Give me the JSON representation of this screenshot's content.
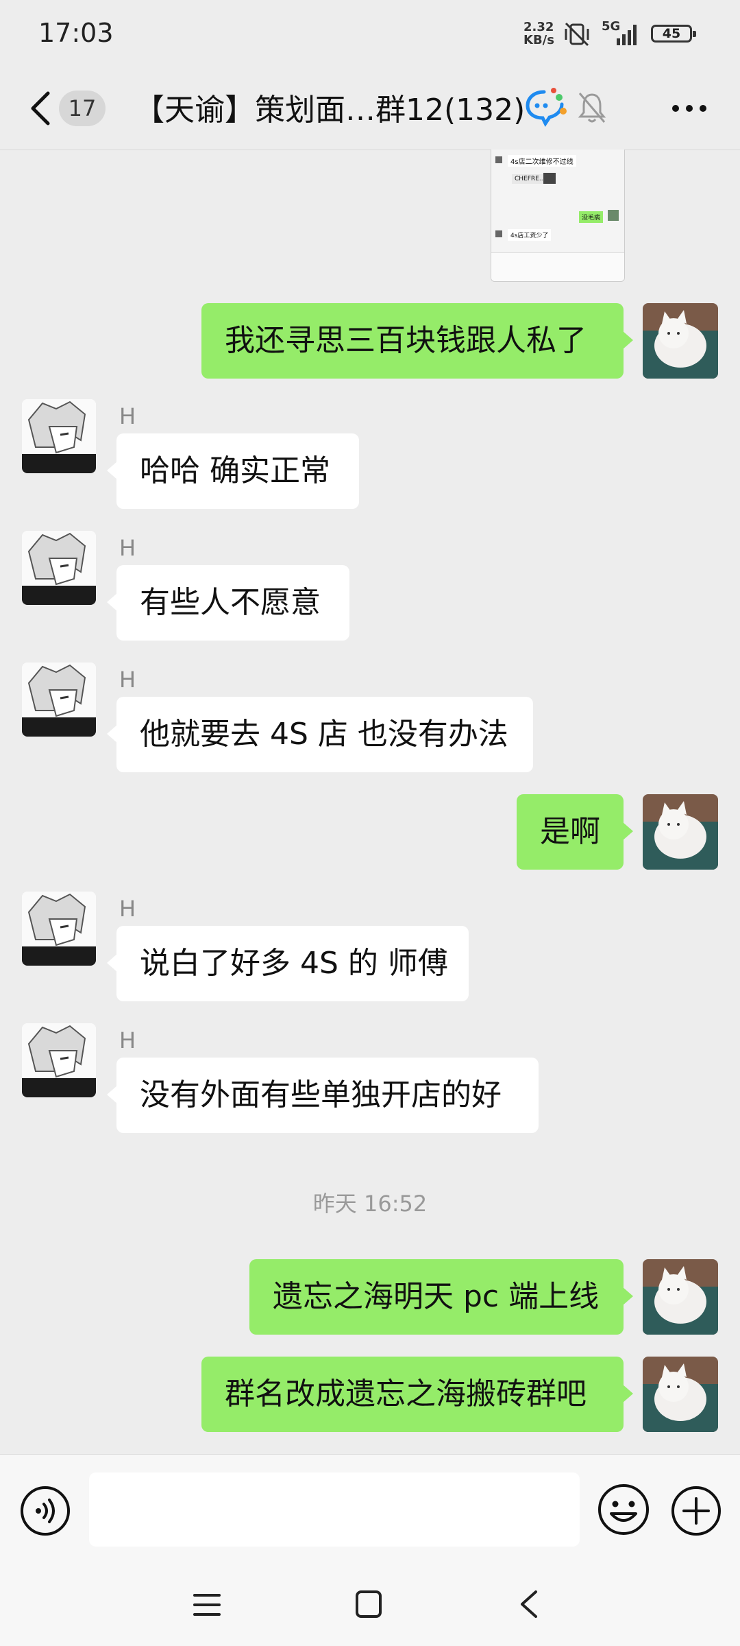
{
  "status_bar": {
    "time": "17:03",
    "net_speed_value": "2.32",
    "net_speed_unit": "KB/s",
    "network": "5G",
    "battery": "45"
  },
  "header": {
    "unread_count": "17",
    "title": "【天谕】策划面…群12(132)"
  },
  "messages": [
    {
      "side": "right",
      "text": "我还寻思三百块钱跟人私了"
    },
    {
      "side": "left",
      "sender": "H",
      "text": "哈哈 确实正常"
    },
    {
      "side": "left",
      "sender": "H",
      "text": "有些人不愿意"
    },
    {
      "side": "left",
      "sender": "H",
      "text": "他就要去 4S 店 也没有办法"
    },
    {
      "side": "right",
      "text": "是啊"
    },
    {
      "side": "left",
      "sender": "H",
      "text": "说白了好多 4S 的 师傅"
    },
    {
      "side": "left",
      "sender": "H",
      "text": "没有外面有些单独开店的好"
    },
    {
      "type": "timestamp",
      "text": "昨天 16:52"
    },
    {
      "side": "right",
      "text": "遗忘之海明天 pc 端上线"
    },
    {
      "side": "right",
      "text": "群名改成遗忘之海搬砖群吧"
    }
  ],
  "thumbnail": {
    "line1": "4s店二次维修不过线",
    "line2": "CHEFRE...E",
    "line3": "没毛病",
    "line4": "4s店工资少了"
  },
  "colors": {
    "background": "#ededed",
    "bubble_self": "#95ec69",
    "bubble_other": "#ffffff"
  },
  "icons": {
    "back": "chevron-left-icon",
    "chat_bubble": "chat-bubble-icon",
    "mute": "bell-off-icon",
    "more": "more-dots-icon",
    "voice": "voice-icon",
    "emoji": "emoji-icon",
    "plus": "plus-icon"
  }
}
